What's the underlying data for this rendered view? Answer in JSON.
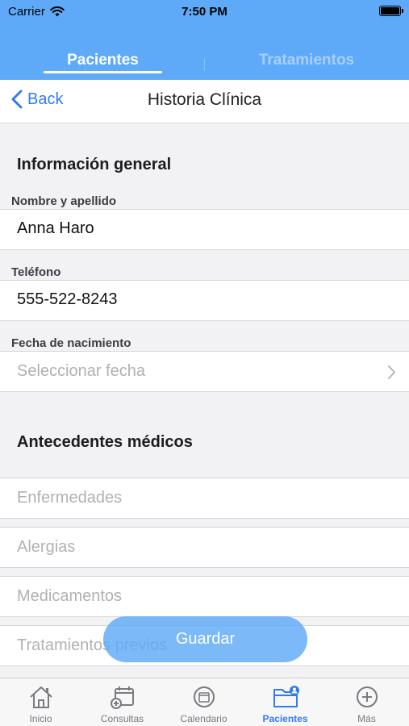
{
  "status_bar": {
    "carrier": "Carrier",
    "time": "7:50 PM"
  },
  "top_tabs": [
    {
      "label": "Pacientes",
      "active": true
    },
    {
      "label": "Tratamientos",
      "active": false
    }
  ],
  "nav": {
    "back_label": "Back",
    "title": "Historia Clínica"
  },
  "general": {
    "section_title": "Información general",
    "name_label": "Nombre y apellido",
    "name_value": "Anna Haro",
    "phone_label": "Teléfono",
    "phone_value": "555-522-8243",
    "birth_label": "Fecha de nacimiento",
    "birth_placeholder": "Seleccionar fecha"
  },
  "medical": {
    "section_title": "Antecedentes médicos",
    "diseases_placeholder": "Enfermedades",
    "allergies_placeholder": "Alergias",
    "medications_placeholder": "Medicamentos",
    "treatments_placeholder": "Tratamientos previos"
  },
  "save_button": "Guardar",
  "tab_bar": [
    {
      "label": "Inicio",
      "icon": "home-icon",
      "active": false
    },
    {
      "label": "Consultas",
      "icon": "calendar-add-icon",
      "active": false
    },
    {
      "label": "Calendario",
      "icon": "calendar-icon",
      "active": false
    },
    {
      "label": "Pacientes",
      "icon": "patients-folder-icon",
      "active": true
    },
    {
      "label": "Más",
      "icon": "plus-circle-icon",
      "active": false
    }
  ],
  "colors": {
    "accent": "#2f7bf5",
    "header": "#5eaaf8",
    "background": "#f2f2f4"
  }
}
